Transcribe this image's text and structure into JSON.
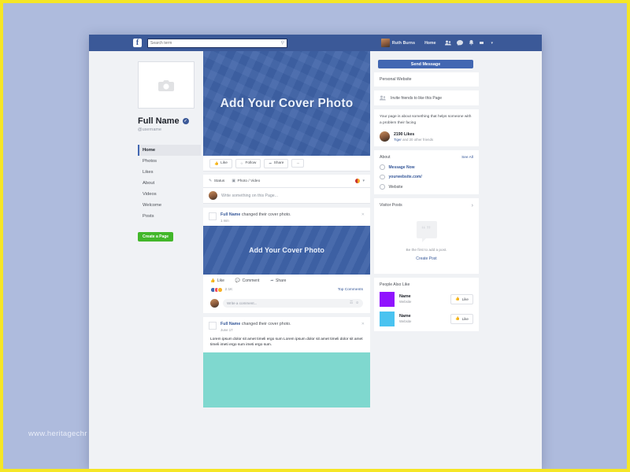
{
  "topbar": {
    "logo": "f",
    "search_placeholder": "Search term",
    "search_value": "Search term",
    "search_icon": "search-icon",
    "user_name": "Ruth Burns",
    "home_label": "Home",
    "icons": [
      "friend-requests-icon",
      "messages-icon",
      "notifications-icon",
      "account-menu-icon"
    ],
    "caret": "▾"
  },
  "sidebar": {
    "profile_photo_placeholder": "camera-icon",
    "full_name": "Full Name",
    "verified_badge": "✓",
    "username": "@username",
    "items": [
      {
        "label": "Home",
        "active": true
      },
      {
        "label": "Photos",
        "active": false
      },
      {
        "label": "Likes",
        "active": false
      },
      {
        "label": "About",
        "active": false
      },
      {
        "label": "Videos",
        "active": false
      },
      {
        "label": "Welcome",
        "active": false
      },
      {
        "label": "Posts",
        "active": false
      }
    ],
    "create_page_label": "Create a Page",
    "create_page_color": "#42b72a"
  },
  "cover": {
    "text": "Add Your Cover Photo",
    "color": "#3f63a8"
  },
  "actions": {
    "like": "Like",
    "follow": "Follow",
    "share": "Share",
    "more": "...",
    "send_message": "Send Message",
    "send_message_color": "#4267b2"
  },
  "composer": {
    "status_tab": "Status",
    "photo_video_tab": "Photo / Video",
    "placeholder": "Write something on this Page..."
  },
  "posts": [
    {
      "author": "Full Name",
      "action": "changed their cover photo.",
      "time": "1 min",
      "cover_text": "Add Your Cover Photo",
      "like": "Like",
      "comment": "Comment",
      "share": "Share",
      "reaction_count": "2.1K",
      "top_comments": "Top Comments",
      "comment_placeholder": "Write a comment..."
    },
    {
      "author": "Full Name",
      "action": "changed their cover photo.",
      "time": "June 17",
      "body": "Lorem ipsum dolor sit amet timeli ergo sum Lorem ipsum dolor sit amet timeli dolor sit amet timeli imeti ergo sum imeti ergo sum."
    }
  ],
  "right": {
    "personal_website": "Personal Website",
    "invite_text": "Invite friends to like this Page",
    "page_description": "Your page is about something that helps someone with a problem their facing",
    "likes_count": "2190 Likes",
    "likes_friends_prefix": "Tiger",
    "likes_friends_suffix": " and 20 other friends",
    "about_title": "About",
    "see_all": "See All",
    "about_items": [
      {
        "label": "Message Now",
        "icon": "message-icon",
        "link": true
      },
      {
        "label": "yourwebsite.com/",
        "icon": "link-icon",
        "link": true
      },
      {
        "label": "Website",
        "icon": "globe-icon",
        "link": false
      }
    ],
    "visitor_posts_title": "Visitor Posts",
    "visitor_posts_chevron": "›",
    "visitor_empty_text": "Be the first to add a post.",
    "create_post_label": "Create Post",
    "people_also_like_title": "People Also Like",
    "people": [
      {
        "name": "Name",
        "sub": "Website",
        "color": "#9013fe",
        "like_label": "Like"
      },
      {
        "name": "Name",
        "sub": "Website",
        "color": "#4ac3f0",
        "like_label": "Like"
      }
    ]
  },
  "watermark": "www.heritagechr"
}
